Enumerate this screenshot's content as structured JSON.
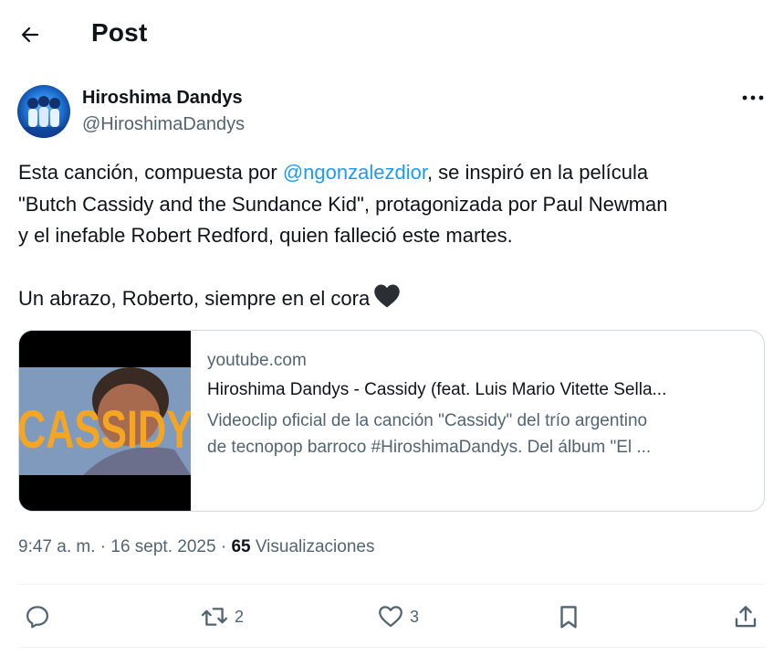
{
  "header": {
    "title": "Post",
    "back_icon": "arrow-left-icon"
  },
  "author": {
    "name": "Hiroshima Dandys",
    "handle": "@HiroshimaDandys",
    "avatar_icon": "avatar-photo",
    "more_icon": "more-horizontal-icon"
  },
  "post": {
    "line1_pre": "Esta canción, compuesta por ",
    "mention": "@ngonzalezdior",
    "line1_post": ", se inspiró en la película",
    "line2": "\"Butch Cassidy and the Sundance Kid\", protagonizada por Paul Newman",
    "line3": "y el inefable Robert Redford, quien falleció este martes.",
    "line4": "Un abrazo, Roberto, siempre en el cora",
    "emoji": "black-heart-icon"
  },
  "card": {
    "domain": "youtube.com",
    "title": "Hiroshima Dandys - Cassidy (feat. Luis Mario Vitette Sella...",
    "desc_line1": "Videoclip oficial de la canción \"Cassidy\" del trío argentino",
    "desc_line2": "de tecnopop barroco #HiroshimaDandys. Del álbum \"El ...",
    "thumbnail_text": "CASSIDY"
  },
  "meta": {
    "time": "9:47 a. m.",
    "sep1": " · ",
    "date": "16 sept. 2025",
    "sep2": " · ",
    "views_count": "65",
    "views_label": " Visualizaciones"
  },
  "actions": {
    "reply_icon": "reply-icon",
    "repost_icon": "repost-icon",
    "repost_count": "2",
    "like_icon": "heart-outline-icon",
    "like_count": "3",
    "bookmark_icon": "bookmark-icon",
    "share_icon": "share-icon"
  },
  "colors": {
    "text": "#0f1419",
    "secondary": "#536471",
    "link": "#1d9bf0",
    "border": "#cfd9de",
    "thumbnail_text": "#f4a623"
  }
}
